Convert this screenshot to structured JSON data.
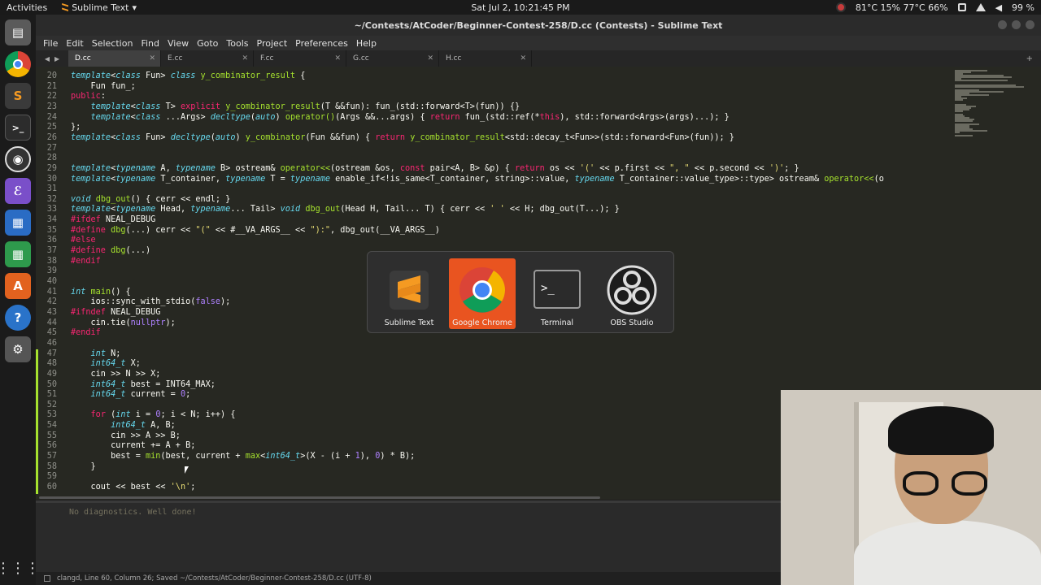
{
  "topbar": {
    "activities": "Activities",
    "app_menu": "Sublime Text",
    "clock": "Sat Jul  2, 10:21:45 PM",
    "status": "81°C 15% 77°C 66%",
    "battery": "99 %"
  },
  "window": {
    "title": "~/Contests/AtCoder/Beginner-Contest-258/D.cc (Contests) - Sublime Text"
  },
  "menu": [
    "File",
    "Edit",
    "Selection",
    "Find",
    "View",
    "Goto",
    "Tools",
    "Project",
    "Preferences",
    "Help"
  ],
  "tabs": [
    {
      "label": "D.cc",
      "active": true
    },
    {
      "label": "E.cc",
      "active": false
    },
    {
      "label": "F.cc",
      "active": false
    },
    {
      "label": "G.cc",
      "active": false
    },
    {
      "label": "H.cc",
      "active": false
    }
  ],
  "code_lines": [
    {
      "n": "20",
      "html": "<span class=\"kw\">template</span>&lt;<span class=\"kw\">class</span> Fun&gt; <span class=\"kw\">class</span> <span class=\"fn\">y_combinator_result</span> {"
    },
    {
      "n": "21",
      "html": "    Fun fun_;"
    },
    {
      "n": "22",
      "html": "<span class=\"kr\">public</span>:"
    },
    {
      "n": "23",
      "html": "    <span class=\"kw\">template</span>&lt;<span class=\"kw\">class</span> T&gt; <span class=\"kr\">explicit</span> <span class=\"fn\">y_combinator_result</span>(T &amp;&amp;fun): fun_(std::forward&lt;T&gt;(fun)) {}"
    },
    {
      "n": "24",
      "html": "    <span class=\"kw\">template</span>&lt;<span class=\"kw\">class</span> ...Args&gt; <span class=\"kw\">decltype</span>(<span class=\"kw\">auto</span>) <span class=\"fn\">operator()</span>(Args &amp;&amp;...args) { <span class=\"kr\">return</span> fun_(std::ref(*<span class=\"kr\">this</span>), std::forward&lt;Args&gt;(args)...); }"
    },
    {
      "n": "25",
      "html": "};"
    },
    {
      "n": "26",
      "html": "<span class=\"kw\">template</span>&lt;<span class=\"kw\">class</span> Fun&gt; <span class=\"kw\">decltype</span>(<span class=\"kw\">auto</span>) <span class=\"fn\">y_combinator</span>(Fun &amp;&amp;fun) { <span class=\"kr\">return</span> <span class=\"fn\">y_combinator_result</span>&lt;std::decay_t&lt;Fun&gt;&gt;(std::forward&lt;Fun&gt;(fun)); }"
    },
    {
      "n": "27",
      "html": ""
    },
    {
      "n": "28",
      "html": ""
    },
    {
      "n": "29",
      "html": "<span class=\"kw\">template</span>&lt;<span class=\"kw\">typename</span> A, <span class=\"kw\">typename</span> B&gt; ostream&amp; <span class=\"fn\">operator&lt;&lt;</span>(ostream &amp;os, <span class=\"kr\">const</span> pair&lt;A, B&gt; &amp;p) { <span class=\"kr\">return</span> os &lt;&lt; <span class=\"str\">'('</span> &lt;&lt; p.first &lt;&lt; <span class=\"str\">\", \"</span> &lt;&lt; p.second &lt;&lt; <span class=\"str\">')'</span>; }"
    },
    {
      "n": "30",
      "html": "<span class=\"kw\">template</span>&lt;<span class=\"kw\">typename</span> T_container, <span class=\"kw\">typename</span> T = <span class=\"kw\">typename</span> enable_if&lt;!is_same&lt;T_container, string&gt;::value, <span class=\"kw\">typename</span> T_container::value_type&gt;::type&gt; ostream&amp; <span class=\"fn\">operator&lt;&lt;</span>(o"
    },
    {
      "n": "31",
      "html": ""
    },
    {
      "n": "32",
      "html": "<span class=\"kw\">void</span> <span class=\"fn\">dbg_out</span>() { cerr &lt;&lt; endl; }"
    },
    {
      "n": "33",
      "html": "<span class=\"kw\">template</span>&lt;<span class=\"kw\">typename</span> Head, <span class=\"kw\">typename</span>... Tail&gt; <span class=\"kw\">void</span> <span class=\"fn\">dbg_out</span>(Head H, Tail... T) { cerr &lt;&lt; <span class=\"str\">' '</span> &lt;&lt; H; dbg_out(T...); }"
    },
    {
      "n": "34",
      "html": "<span class=\"kr\">#ifdef</span> NEAL_DEBUG"
    },
    {
      "n": "35",
      "html": "<span class=\"kr\">#define</span> <span class=\"fn\">dbg</span>(...) cerr &lt;&lt; <span class=\"str\">\"(\"</span> &lt;&lt; #__VA_ARGS__ &lt;&lt; <span class=\"str\">\"):\"</span>, dbg_out(__VA_ARGS__)"
    },
    {
      "n": "36",
      "html": "<span class=\"kr\">#else</span>"
    },
    {
      "n": "37",
      "html": "<span class=\"kr\">#define</span> <span class=\"fn\">dbg</span>(...)"
    },
    {
      "n": "38",
      "html": "<span class=\"kr\">#endif</span>"
    },
    {
      "n": "39",
      "html": ""
    },
    {
      "n": "40",
      "html": ""
    },
    {
      "n": "41",
      "html": "<span class=\"kw\">int</span> <span class=\"fn\">main</span>() {"
    },
    {
      "n": "42",
      "html": "    ios::sync_with_stdio(<span class=\"num\">false</span>);"
    },
    {
      "n": "43",
      "html": "<span class=\"kr\">#ifndef</span> NEAL_DEBUG"
    },
    {
      "n": "44",
      "html": "    cin.tie(<span class=\"num\">nullptr</span>);"
    },
    {
      "n": "45",
      "html": "<span class=\"kr\">#endif</span>"
    },
    {
      "n": "46",
      "html": ""
    },
    {
      "n": "47",
      "html": "    <span class=\"kw\">int</span> N;"
    },
    {
      "n": "48",
      "html": "    <span class=\"kw\">int64_t</span> X;"
    },
    {
      "n": "49",
      "html": "    cin &gt;&gt; N &gt;&gt; X;"
    },
    {
      "n": "50",
      "html": "    <span class=\"kw\">int64_t</span> best = INT64_MAX;"
    },
    {
      "n": "51",
      "html": "    <span class=\"kw\">int64_t</span> current = <span class=\"num\">0</span>;"
    },
    {
      "n": "52",
      "html": ""
    },
    {
      "n": "53",
      "html": "    <span class=\"kr\">for</span> (<span class=\"kw\">int</span> i = <span class=\"num\">0</span>; i &lt; N; i++) {"
    },
    {
      "n": "54",
      "html": "        <span class=\"kw\">int64_t</span> A, B;"
    },
    {
      "n": "55",
      "html": "        cin &gt;&gt; A &gt;&gt; B;"
    },
    {
      "n": "56",
      "html": "        current += A + B;"
    },
    {
      "n": "57",
      "html": "        best = <span class=\"fn\">min</span>(best, current + <span class=\"fn\">max</span>&lt;<span class=\"kw\">int64_t</span>&gt;(X - (i + <span class=\"num\">1</span>), <span class=\"num\">0</span>) * B);"
    },
    {
      "n": "58",
      "html": "    }"
    },
    {
      "n": "59",
      "html": ""
    },
    {
      "n": "60",
      "html": "    cout &lt;&lt; best &lt;&lt; <span class=\"str\">'\\n'</span>;"
    }
  ],
  "switcher": [
    {
      "label": "Sublime Text",
      "selected": false
    },
    {
      "label": "Google Chrome",
      "selected": true
    },
    {
      "label": "Terminal",
      "selected": false
    },
    {
      "label": "OBS Studio",
      "selected": false
    }
  ],
  "panel": {
    "message": "No diagnostics. Well done!"
  },
  "statusbar": {
    "text": "clangd, Line 60, Column 26; Saved ~/Contests/AtCoder/Beginner-Contest-258/D.cc (UTF-8)"
  },
  "colors": {
    "accent": "#e95420",
    "editor_bg": "#272822"
  }
}
